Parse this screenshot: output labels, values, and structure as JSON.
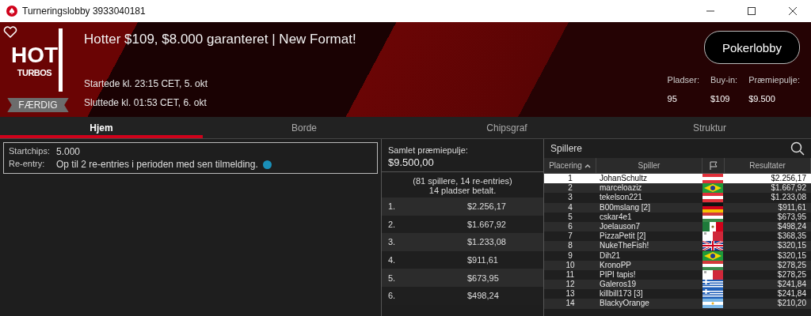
{
  "window": {
    "title": "Turneringslobby 3933040181"
  },
  "header": {
    "favorite": false,
    "logo": {
      "top": "HOT",
      "bottom": "TURBOS"
    },
    "status": "FÆRDIG",
    "title": "Hotter $109, $8.000 garanteret | New Format!",
    "started": "Startede kl. 23:15 CET, 5. okt",
    "ended": "Sluttede kl. 01:53 CET, 6. okt",
    "lobby_button": "Pokerlobby",
    "stats": [
      {
        "label": "Pladser:",
        "value": "95"
      },
      {
        "label": "Buy-in:",
        "value": "$109"
      },
      {
        "label": "Præmiepulje:",
        "value": "$9.500"
      }
    ]
  },
  "tabs": [
    {
      "label": "Hjem",
      "selected": true
    },
    {
      "label": "Borde",
      "selected": false
    },
    {
      "label": "Chipsgraf",
      "selected": false
    },
    {
      "label": "Struktur",
      "selected": false
    }
  ],
  "info": [
    {
      "label": "Startchips:",
      "value": "5.000",
      "has_info": false
    },
    {
      "label": "Re-entry:",
      "value": "Op til 2 re-entries i perioden med sen tilmelding.",
      "has_info": true
    }
  ],
  "prize_pool": {
    "label": "Samlet præmiepulje:",
    "amount": "$9.500,00",
    "entries": "(81 spillere, 14 re-entries)",
    "paid": "14 pladser betalt.",
    "rows": [
      {
        "place": "1.",
        "amount": "$2.256,17"
      },
      {
        "place": "2.",
        "amount": "$1.667,92"
      },
      {
        "place": "3.",
        "amount": "$1.233,08"
      },
      {
        "place": "4.",
        "amount": "$911,61"
      },
      {
        "place": "5.",
        "amount": "$673,95"
      },
      {
        "place": "6.",
        "amount": "$498,24"
      }
    ]
  },
  "players": {
    "title": "Spillere",
    "columns": [
      "Placering",
      "Spiller",
      "Resultater"
    ],
    "rows": [
      {
        "place": "1",
        "name": "JohanSchultz",
        "kind": "austria",
        "result": "$2.256,17",
        "selected": true
      },
      {
        "place": "2",
        "name": "marceloaziz",
        "kind": "brazil",
        "result": "$1.667,92",
        "selected": false
      },
      {
        "place": "3",
        "name": "tekelson221",
        "kind": "austria",
        "result": "$1.233,08",
        "selected": false
      },
      {
        "place": "4",
        "name": "B00mslang [2]",
        "kind": "germany",
        "result": "$911,61",
        "selected": false
      },
      {
        "place": "5",
        "name": "cskar4e1",
        "kind": "hungary",
        "result": "$673,95",
        "selected": false
      },
      {
        "place": "6",
        "name": "Joelauson7",
        "kind": "mexico",
        "result": "$498,24",
        "selected": false
      },
      {
        "place": "7",
        "name": "PizzaPetit [2]",
        "kind": "malta",
        "result": "$368,35",
        "selected": false
      },
      {
        "place": "8",
        "name": "NukeTheFish!",
        "kind": "uk",
        "result": "$320,15",
        "selected": false
      },
      {
        "place": "9",
        "name": "Dih21",
        "kind": "brazil",
        "result": "$320,15",
        "selected": false
      },
      {
        "place": "10",
        "name": "KronoPP",
        "kind": "hungary",
        "result": "$278,25",
        "selected": false
      },
      {
        "place": "11",
        "name": "PIPI tapis!",
        "kind": "malta",
        "result": "$278,25",
        "selected": false
      },
      {
        "place": "12",
        "name": "Galeros19",
        "kind": "greece",
        "result": "$241,84",
        "selected": false
      },
      {
        "place": "13",
        "name": "killbill173 [3]",
        "kind": "greece",
        "result": "$241,84",
        "selected": false
      },
      {
        "place": "14",
        "name": "BlackyOrange",
        "kind": "argentina",
        "result": "$210,20",
        "selected": false
      }
    ]
  }
}
